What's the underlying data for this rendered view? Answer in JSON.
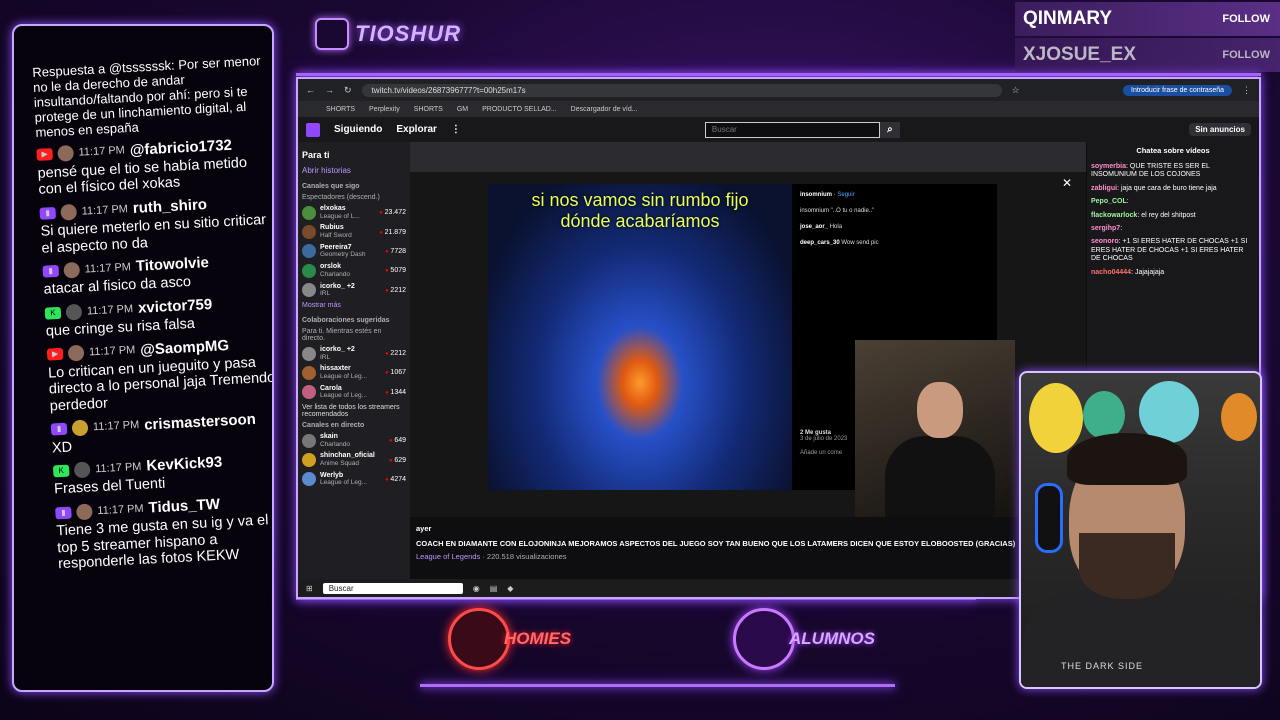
{
  "brand": {
    "name": "TIOSHUR"
  },
  "top_right": [
    {
      "name": "QINMARY",
      "action": "FOLLOW"
    },
    {
      "name": "XJOSUE_EX",
      "action": "FOLLOW"
    }
  ],
  "overlay_chat": [
    {
      "badge": "",
      "time": "",
      "name": "",
      "text": "Respuesta a @tssssssk: Por ser menor no le da derecho de andar insultando/faltando por ahí: pero si te protege de un linchamiento digital, al menos en españa"
    },
    {
      "badge": "yt",
      "time": "11:17 PM",
      "name": "@fabricio1732",
      "text": "pensé que el tio se había metido con el físico del xokas"
    },
    {
      "badge": "tw",
      "time": "11:17 PM",
      "name": "ruth_shiro",
      "text": "Si quiere meterlo en su sitio criticar el aspecto no da"
    },
    {
      "badge": "tw",
      "time": "11:17 PM",
      "name": "Titowolvie",
      "text": "atacar al fisico da asco"
    },
    {
      "badge": "kk",
      "time": "11:17 PM",
      "name": "xvictor759",
      "text": "que cringe su risa falsa"
    },
    {
      "badge": "yt",
      "time": "11:17 PM",
      "name": "@SaompMG",
      "text": "Lo critican en un jueguito y pasa directo a lo personal jaja Tremendo perdedor"
    },
    {
      "badge": "tw",
      "time": "11:17 PM",
      "name": "crismastersoon",
      "text": "XD"
    },
    {
      "badge": "kk",
      "time": "11:17 PM",
      "name": "KevKick93",
      "text": "Frases del Tuenti"
    },
    {
      "badge": "tw",
      "time": "11:17 PM",
      "name": "Tidus_TW",
      "text": "Tiene 3 me gusta en su ig y va el top 5 streamer hispano a responderle las fotos KEKW"
    }
  ],
  "browser": {
    "url": "twitch.tv/videos/2687396777?t=00h25m17s",
    "extension_label": "Introducir frase de contraseña",
    "bookmarks": [
      "SHORTS",
      "Perplexity",
      "SHORTS",
      "GM",
      "PRODUCTO SELLAD...",
      "Descargador de víd..."
    ],
    "nav": {
      "following": "Siguiendo",
      "explore": "Explorar",
      "search_placeholder": "Buscar",
      "ad_free": "Sin anuncios"
    },
    "sidebar": {
      "title": "Para ti",
      "stories": "Abrir historias",
      "followed_title": "Canales que sigo",
      "followed_sub": "Espectadores (descend.)",
      "followed": [
        {
          "name": "elxokas",
          "game": "League of L...",
          "viewers": "23.472"
        },
        {
          "name": "Rubius",
          "game": "Half Sword",
          "viewers": "21.879"
        },
        {
          "name": "Peereira7",
          "game": "Geometry Dash",
          "viewers": "7728"
        },
        {
          "name": "orslok",
          "game": "Charlando",
          "viewers": "5079"
        },
        {
          "name": "icorko_ +2",
          "game": "IRL",
          "viewers": "2212"
        }
      ],
      "show_more": "Mostrar más",
      "suggested_title": "Colaboraciones sugeridas",
      "suggested_sub": "Para ti. Mientras estés en directo.",
      "suggested": [
        {
          "name": "icorko_ +2",
          "game": "IRL",
          "viewers": "2212"
        },
        {
          "name": "hissaxter",
          "game": "League of Leg...",
          "viewers": "1067"
        },
        {
          "name": "Carola",
          "game": "League of Leg...",
          "viewers": "1344"
        }
      ],
      "recommended_link": "Ver lista de todos los streamers recomendados",
      "live_title": "Canales en directo",
      "live": [
        {
          "name": "skain",
          "game": "Charlando",
          "viewers": "649"
        },
        {
          "name": "shinchan_oficial",
          "game": "Anime Squad",
          "viewers": "629"
        },
        {
          "name": "Werlyb",
          "game": "League of Leg...",
          "viewers": "4274"
        }
      ]
    },
    "video": {
      "overlay_text": "si nos vamos sin rumbo fijo dónde acabaríamos",
      "ig_user": "insomnium",
      "ig_follow": "Seguir",
      "ig_caption": "insomnium \"..O tu o nadie..\"",
      "ig_comment1_user": "jose_aor_",
      "ig_comment1": "Hola",
      "ig_comment2_user": "deep_cars_30",
      "ig_comment2": "Wow send pic",
      "ig_likes": "2 Me gusta",
      "ig_date": "3 de julio de 2023",
      "ig_add_comment": "Añade un come"
    },
    "video_info": {
      "when": "ayer",
      "title": "COACH EN DIAMANTE CON ELOJONINJA MEJORAMOS ASPECTOS DEL JUEGO SOY TAN BUENO QUE LOS LATAMERS DICEN QUE ESTOY ELOBOOSTED (GRACIAS)",
      "category": "League of Legends",
      "views": "220.518 visualizaciones"
    },
    "chat": {
      "title": "Chatea sobre vídeos",
      "messages": [
        {
          "user": "soymerbia",
          "text": "QUE TRISTE ES SER EL INSOMUNIUM DE LOS COJONES"
        },
        {
          "user": "zabligui",
          "text": "jaja que cara de buro tiene jaja"
        },
        {
          "user": "Pepo_COL",
          "text": ""
        },
        {
          "user": "flackowarlock",
          "text": "el rey del shitpost"
        },
        {
          "user": "sergihp7",
          "text": ""
        },
        {
          "user": "seonoro",
          "text": "+1 SI ERES HATER DE CHOCAS +1 SI ERES HATER DE CHOCAS +1 SI ERES HATER DE CHOCAS"
        },
        {
          "user": "nacho04444",
          "text": "Jajajajaja"
        }
      ]
    },
    "taskbar_search": "Buscar"
  },
  "webcam": {
    "shirt_text": "THE DARK SIDE"
  },
  "bottom_logos": [
    {
      "label": "HOMIES"
    },
    {
      "label": "ALUMNOS"
    }
  ]
}
